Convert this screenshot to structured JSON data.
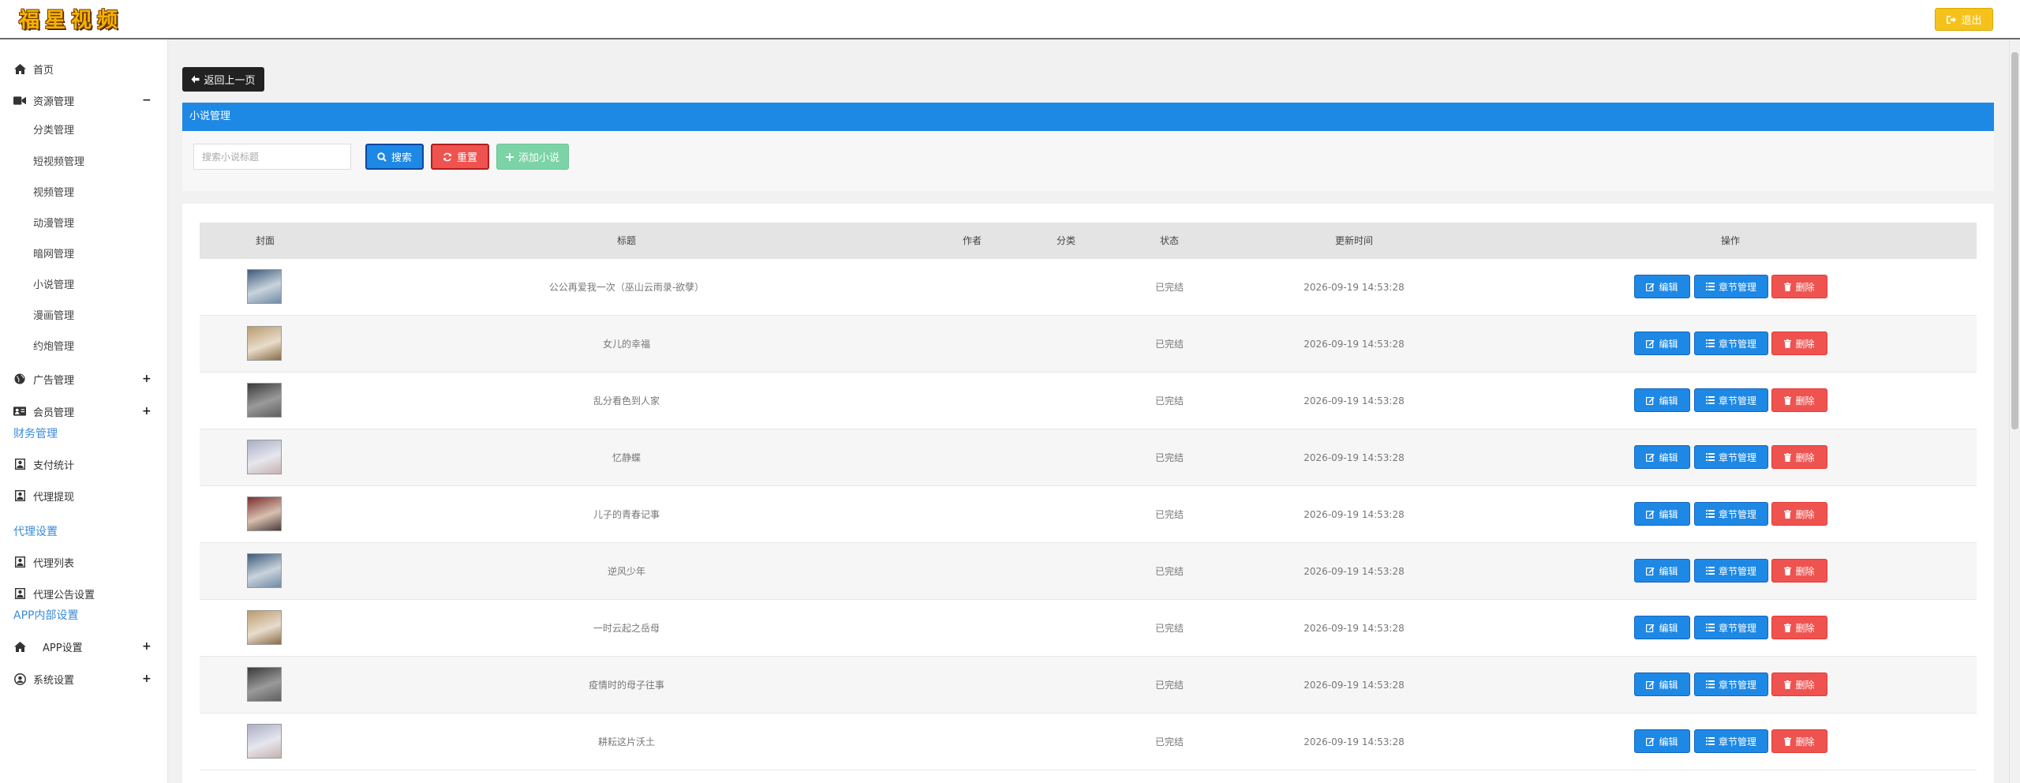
{
  "app": {
    "logo_chars": [
      "福",
      "星",
      "视",
      "频"
    ],
    "logout_label": "退出"
  },
  "sidebar": {
    "home": "首页",
    "resource": {
      "label": "资源管理",
      "toggle": "−",
      "children": [
        "分类管理",
        "短视频管理",
        "视频管理",
        "动漫管理",
        "暗网管理",
        "小说管理",
        "漫画管理",
        "约炮管理"
      ]
    },
    "ads": {
      "label": "广告管理",
      "toggle": "+"
    },
    "members": {
      "label": "会员管理",
      "toggle": "+"
    },
    "finance": {
      "label": "财务管理",
      "children": [
        "支付统计",
        "代理提现"
      ]
    },
    "agent": {
      "label": "代理设置",
      "children": [
        "代理列表",
        "代理公告设置"
      ]
    },
    "app_internal": {
      "label": "APP内部设置"
    },
    "app_settings": {
      "label": "APP设置",
      "toggle": "+"
    },
    "system": {
      "label": "系统设置",
      "toggle": "+"
    }
  },
  "main": {
    "back_label": "返回上一页",
    "panel_title": "小说管理",
    "search_placeholder": "搜索小说标题",
    "search_label": "搜索",
    "reset_label": "重置",
    "add_label": "添加小说",
    "columns": [
      "封面",
      "标题",
      "作者",
      "分类",
      "状态",
      "更新时间",
      "操作"
    ],
    "actions": {
      "edit": "编辑",
      "chapters": "章节管理",
      "delete": "删除"
    },
    "rows": [
      {
        "title": "公公再爱我一次（巫山云雨录-欲孽）",
        "author": "",
        "category": "",
        "status": "已完结",
        "updated": "2026-09-19 14:53:28",
        "cover_tone": "blue"
      },
      {
        "title": "女儿的幸福",
        "author": "",
        "category": "",
        "status": "已完结",
        "updated": "2026-09-19 14:53:28",
        "cover_tone": "warm"
      },
      {
        "title": "乱分看色到人家",
        "author": "",
        "category": "",
        "status": "已完结",
        "updated": "2026-09-19 14:53:28",
        "cover_tone": "dark"
      },
      {
        "title": "忆静蝶",
        "author": "",
        "category": "",
        "status": "已完结",
        "updated": "2026-09-19 14:53:28",
        "cover_tone": "light"
      },
      {
        "title": "儿子的青春记事",
        "author": "",
        "category": "",
        "status": "已完结",
        "updated": "2026-09-19 14:53:28",
        "cover_tone": "red"
      },
      {
        "title": "逆风少年",
        "author": "",
        "category": "",
        "status": "已完结",
        "updated": "2026-09-19 14:53:28",
        "cover_tone": "blue"
      },
      {
        "title": "一时云起之岳母",
        "author": "",
        "category": "",
        "status": "已完结",
        "updated": "2026-09-19 14:53:28",
        "cover_tone": "warm"
      },
      {
        "title": "疫情时的母子往事",
        "author": "",
        "category": "",
        "status": "已完结",
        "updated": "2026-09-19 14:53:28",
        "cover_tone": "dark"
      },
      {
        "title": "耕耘这片沃土",
        "author": "",
        "category": "",
        "status": "已完结",
        "updated": "2026-09-19 14:53:28",
        "cover_tone": "light"
      }
    ]
  },
  "colors": {
    "primary": "#1e88e5",
    "danger": "#ef5350",
    "success": "#7bd3a6",
    "warning": "#f5c21b",
    "dark": "#222222"
  },
  "icons": {
    "home": "home-icon",
    "resource": "video-camera-icon",
    "ads": "globe-icon",
    "members": "id-card-icon",
    "finance_item": "user-square-icon",
    "app_settings": "home-icon",
    "system": "user-circle-icon",
    "back": "arrow-left-icon",
    "search": "search-icon",
    "reset": "refresh-icon",
    "add": "plus-icon",
    "edit": "edit-icon",
    "chapters": "list-icon",
    "delete": "trash-icon",
    "logout": "sign-out-icon"
  }
}
